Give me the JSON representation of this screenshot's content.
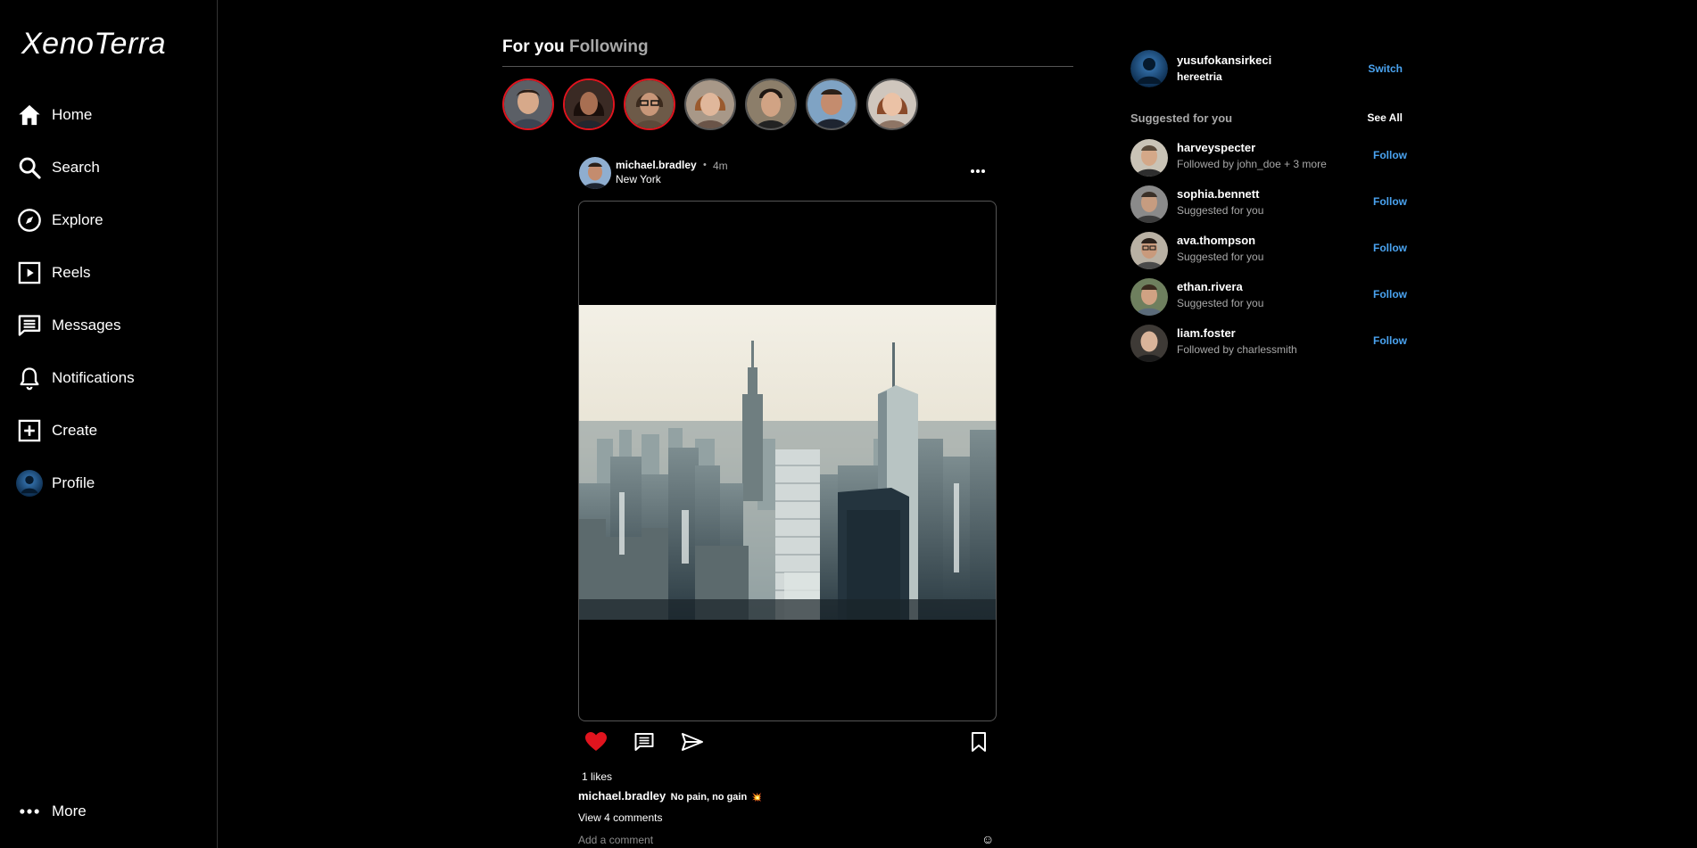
{
  "app": {
    "logo": "XenoTerra"
  },
  "sidebar": {
    "items": [
      {
        "label": "Home",
        "icon": "home-icon"
      },
      {
        "label": "Search",
        "icon": "search-icon"
      },
      {
        "label": "Explore",
        "icon": "compass-icon"
      },
      {
        "label": "Reels",
        "icon": "reels-icon"
      },
      {
        "label": "Messages",
        "icon": "messages-icon"
      },
      {
        "label": "Notifications",
        "icon": "bell-icon"
      },
      {
        "label": "Create",
        "icon": "plus-square-icon"
      },
      {
        "label": "Profile",
        "icon": "profile-avatar-icon"
      }
    ],
    "more": {
      "label": "More",
      "icon": "more-dots-icon"
    }
  },
  "feed": {
    "tabs": [
      {
        "label": "For you",
        "active": true
      },
      {
        "label": "Following",
        "active": false
      }
    ],
    "stories": [
      {
        "ring": "#e0141e"
      },
      {
        "ring": "#e0141e"
      },
      {
        "ring": "#e0141e"
      },
      {
        "ring": "#444444"
      },
      {
        "ring": "#444444"
      },
      {
        "ring": "#444444"
      },
      {
        "ring": "#444444"
      }
    ],
    "post": {
      "username": "michael.bradley",
      "time": "4m",
      "separator": "•",
      "location": "New York",
      "likes": "1 likes",
      "caption_user": "michael.bradley",
      "caption_text": "No pain, no gain",
      "caption_emoji": "💥",
      "view_comments": "View 4 comments",
      "comment_placeholder": "Add a comment",
      "emoji_icon": "☺",
      "liked": true
    }
  },
  "right": {
    "current_user": {
      "username": "yusufokansirkeci",
      "name": "hereetria",
      "switch_label": "Switch"
    },
    "suggested_title": "Suggested for you",
    "see_all": "See All",
    "suggestions": [
      {
        "username": "harveyspecter",
        "sub": "Followed by john_doe + 3 more",
        "action": "Follow"
      },
      {
        "username": "sophia.bennett",
        "sub": "Suggested for you",
        "action": "Follow"
      },
      {
        "username": "ava.thompson",
        "sub": "Suggested for you",
        "action": "Follow"
      },
      {
        "username": "ethan.rivera",
        "sub": "Suggested for you",
        "action": "Follow"
      },
      {
        "username": "liam.foster",
        "sub": "Followed by charlessmith",
        "action": "Follow"
      }
    ]
  },
  "colors": {
    "accent": "#4aa3f0",
    "like": "#e0141e",
    "story_ring": "#e0141e"
  }
}
